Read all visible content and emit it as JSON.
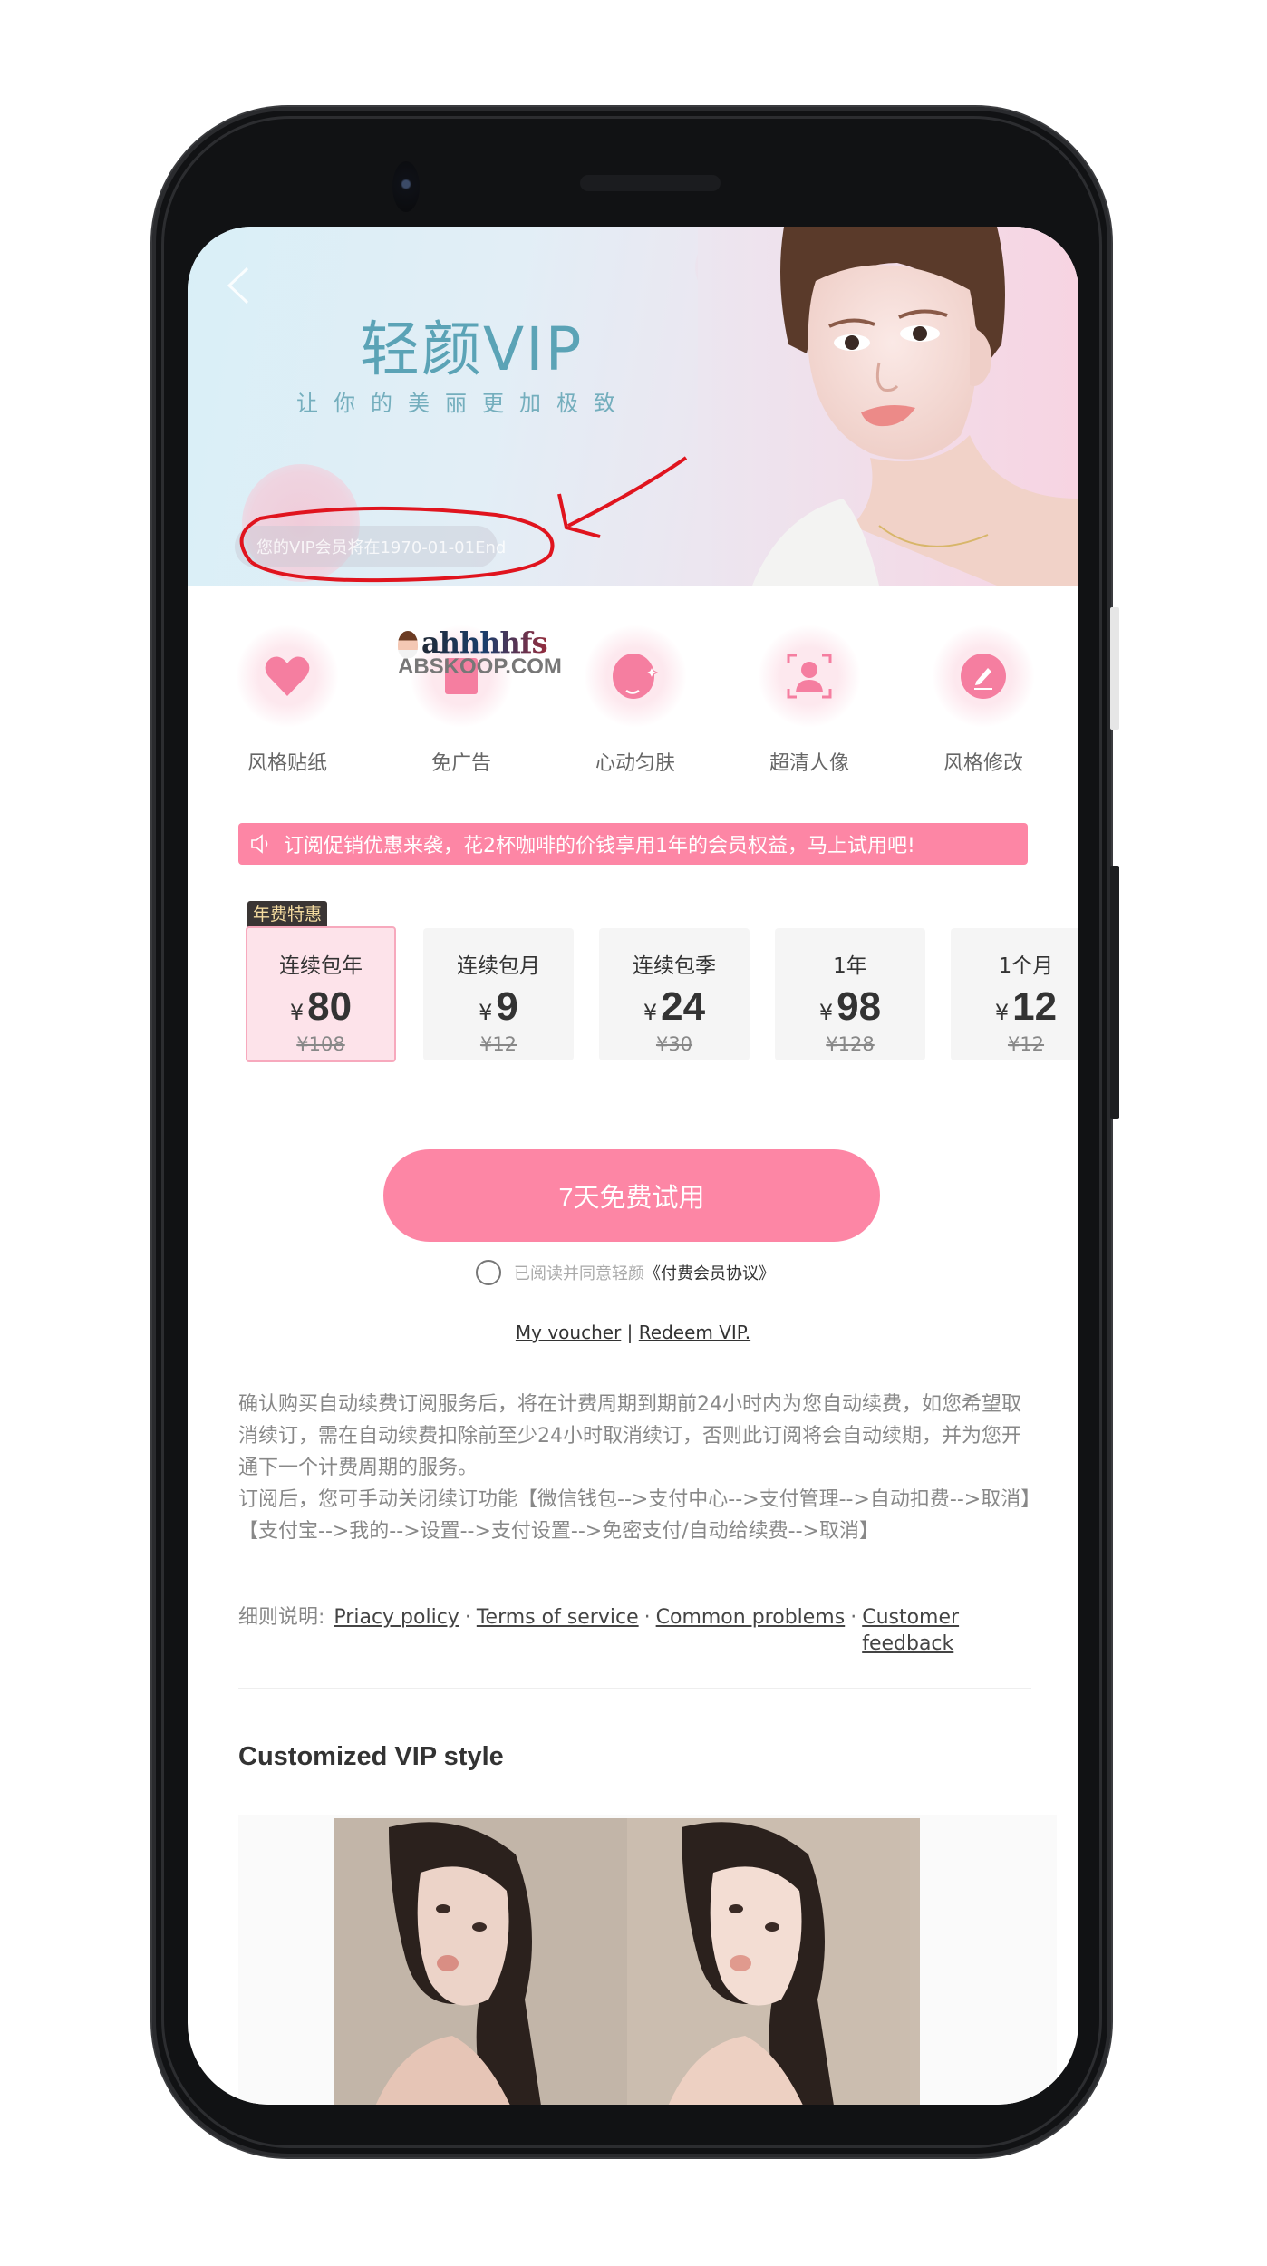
{
  "hero": {
    "title": "轻颜VIP",
    "subtitle": "让你的美丽更加极致",
    "vip_expiry": "您的VIP会员将在1970-01-01End",
    "back_icon": "chevron-left-icon"
  },
  "watermark": {
    "line1": "ahhhhfs",
    "line2": "ABSKOOP.COM"
  },
  "features": [
    {
      "label": "风格贴纸",
      "icon": "heart-icon"
    },
    {
      "label": "免广告",
      "icon": "no-ads-icon"
    },
    {
      "label": "心动匀肤",
      "icon": "smooth-skin-icon"
    },
    {
      "label": "超清人像",
      "icon": "portrait-scan-icon"
    },
    {
      "label": "风格修改",
      "icon": "edit-pencil-icon"
    }
  ],
  "promo": {
    "icon": "speaker-icon",
    "text": "订阅促销优惠来袭，花2杯咖啡的价钱享用1年的会员权益，马上试用吧!"
  },
  "plans": {
    "badge": "年费特惠",
    "currency": "¥",
    "items": [
      {
        "name": "连续包年",
        "price": "80",
        "original": "¥108",
        "selected": true
      },
      {
        "name": "连续包月",
        "price": "9",
        "original": "¥12",
        "selected": false
      },
      {
        "name": "连续包季",
        "price": "24",
        "original": "¥30",
        "selected": false
      },
      {
        "name": "1年",
        "price": "98",
        "original": "¥128",
        "selected": false
      },
      {
        "name": "1个月",
        "price": "12",
        "original": "¥12",
        "selected": false
      }
    ]
  },
  "cta": {
    "label": "7天免费试用"
  },
  "agreement": {
    "text": "已阅读并同意轻颜",
    "link": "《付费会员协议》",
    "checked": false
  },
  "voucher": {
    "my_voucher": "My voucher",
    "separator": "|",
    "redeem": "Redeem VIP."
  },
  "terms": {
    "paragraph1": "确认购买自动续费订阅服务后，将在计费周期到期前24小时内为您自动续费，如您希望取消续订，需在自动续费扣除前至少24小时取消续订，否则此订阅将会自动续期，并为您开通下一个计费周期的服务。",
    "paragraph2": "订阅后，您可手动关闭续订功能【微信钱包-->支付中心-->支付管理-->自动扣费-->取消】【支付宝-->我的-->设置-->支付设置-->免密支付/自动给续费-->取消】"
  },
  "links": {
    "prefix": "细则说明:",
    "privacy": "Priacy policy",
    "tos": "Terms of service",
    "problems": "Common problems",
    "feedback": "Customer feedback",
    "dot": "·"
  },
  "section": {
    "title": "Customized VIP style"
  },
  "colors": {
    "accent_pink": "#fd86a5",
    "selected_plan_bg": "#fde3ea",
    "title_teal": "#5ba3b6",
    "badge_bg": "#3a3534",
    "badge_text": "#f5dca0",
    "annotation_red": "#e0141e"
  }
}
